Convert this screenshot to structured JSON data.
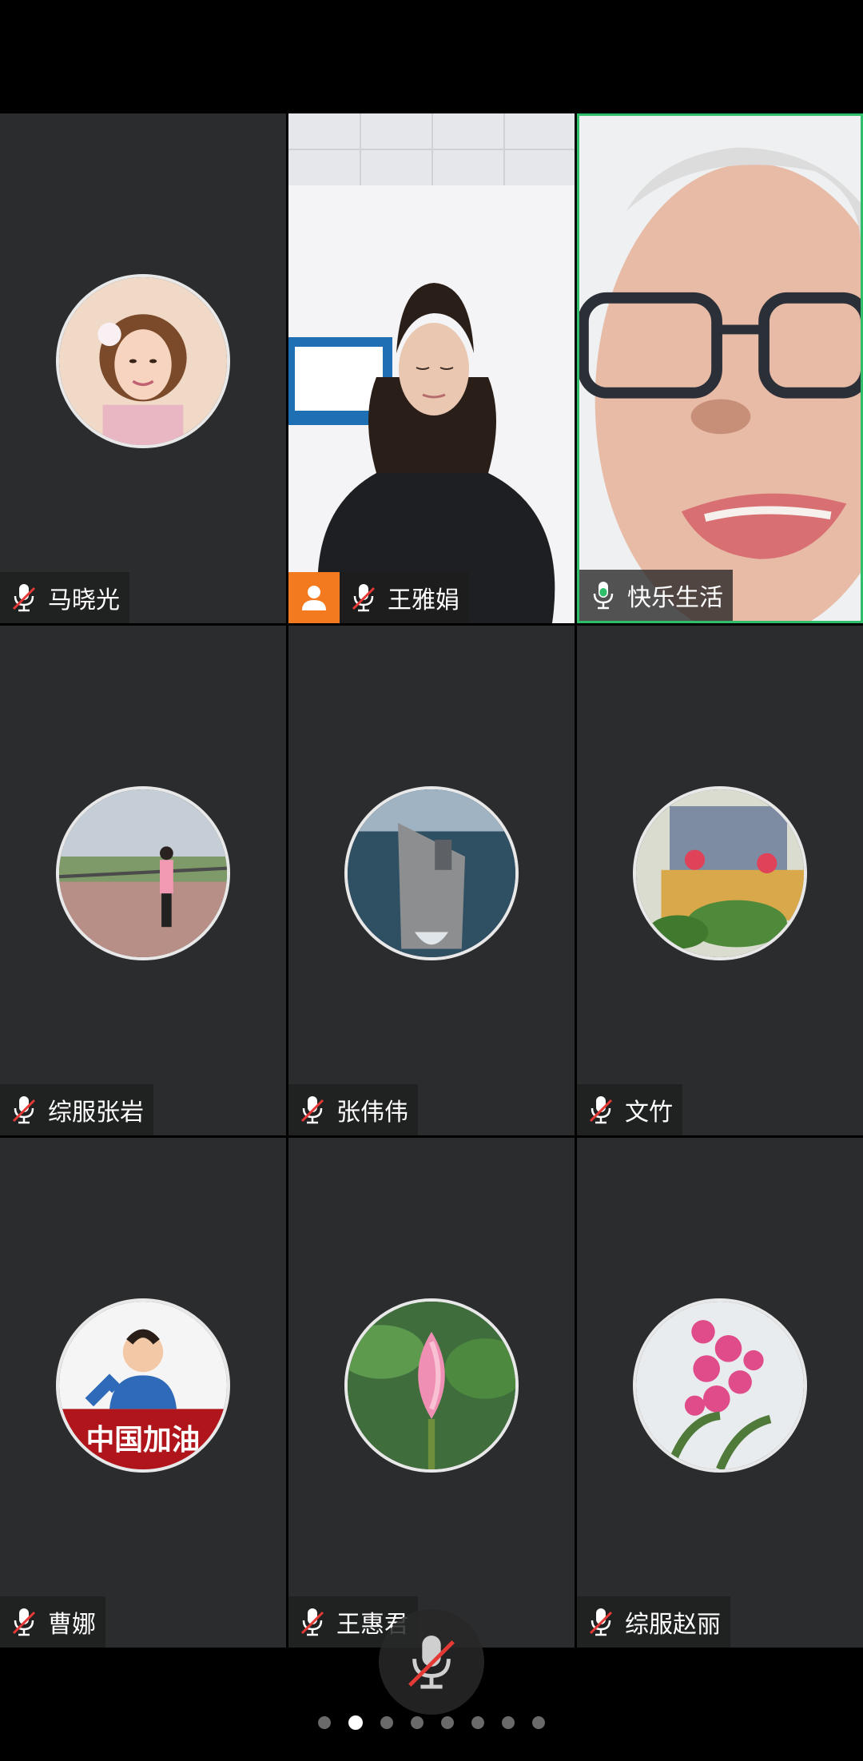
{
  "participants": [
    {
      "name": "马晓光",
      "mic": "muted",
      "kind": "avatar",
      "avatar_icon": "woman-portrait-avatar"
    },
    {
      "name": "王雅娟",
      "mic": "muted",
      "kind": "video",
      "badge": "person-icon"
    },
    {
      "name": "快乐生活",
      "mic": "active",
      "kind": "video",
      "speaking": true
    },
    {
      "name": "综服张岩",
      "mic": "muted",
      "kind": "avatar",
      "avatar_icon": "lakeside-photo-avatar"
    },
    {
      "name": "张伟伟",
      "mic": "muted",
      "kind": "avatar",
      "avatar_icon": "aircraft-carrier-avatar"
    },
    {
      "name": "文竹",
      "mic": "muted",
      "kind": "avatar",
      "avatar_icon": "flowers-room-avatar"
    },
    {
      "name": "曹娜",
      "mic": "muted",
      "kind": "avatar",
      "avatar_icon": "boy-china-cheer-avatar",
      "avatar_text": "中国加油"
    },
    {
      "name": "王惠君",
      "mic": "muted",
      "kind": "avatar",
      "avatar_icon": "lotus-bud-avatar"
    },
    {
      "name": "综服赵丽",
      "mic": "muted",
      "kind": "avatar",
      "avatar_icon": "pink-orchid-avatar"
    }
  ],
  "controls": {
    "floating_mic": "mic-muted-icon"
  },
  "pager": {
    "pages": 8,
    "current": 2
  },
  "colors": {
    "tile_bg": "#2b2c2e",
    "active_border": "#2fbf6b",
    "badge_orange": "#f47a1f",
    "mute_red": "#e53935"
  }
}
